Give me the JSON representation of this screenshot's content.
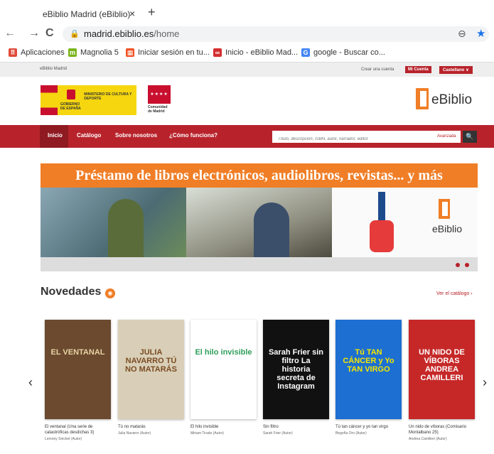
{
  "browser": {
    "tab_title": "eBiblio Madrid (eBiblio)",
    "tab_close": "×",
    "new_tab": "+",
    "back": "←",
    "forward": "→",
    "reload": "C",
    "url_host": "madrid.ebiblio.es",
    "url_path": "/home",
    "zoom": "⊖",
    "star": "★",
    "bookmarks": [
      {
        "label": "Aplicaciones",
        "icon": "apps-grid-icon",
        "color": "#e04b3a",
        "glyph": "⠿"
      },
      {
        "label": "Magnolia 5",
        "icon": "magnolia-icon",
        "color": "#7ab51d",
        "glyph": "m"
      },
      {
        "label": "Iniciar sesión en tu...",
        "icon": "microsoft-icon",
        "color": "#f25022",
        "glyph": "▦"
      },
      {
        "label": "Inicio - eBiblio Mad...",
        "icon": "ebiblio-icon",
        "color": "#d32f2f",
        "glyph": "∞"
      },
      {
        "label": "google - Buscar co...",
        "icon": "google-icon",
        "color": "#4285f4",
        "glyph": "G"
      }
    ]
  },
  "topbar": {
    "brand": "eBiblio Madrid",
    "create_account": "Crear una cuenta",
    "my_account": "Mi Cuenta",
    "language": "Castellano ∨"
  },
  "logos": {
    "gov_left": "GOBIERNO DE ESPAÑA",
    "gov_right": "MINISTERIO DE CULTURA Y DEPORTE",
    "cam_stars": "★★★★",
    "cam_name": "Comunidad de Madrid",
    "ebiblio_name": "eBiblio"
  },
  "nav": {
    "items": [
      "Inicio",
      "Catálogo",
      "Sobre nosotros",
      "¿Cómo funciona?"
    ],
    "search_placeholder": "Título, descripción, ISBN, autor, narrador, editor",
    "advanced": "Avanzada",
    "search_icon": "🔍"
  },
  "banner": {
    "headline": "Préstamo de libros electrónicos, audiolibros, revistas... y más",
    "logo_text": "eBiblio"
  },
  "novedades": {
    "title": "Novedades",
    "rss_glyph": "◉",
    "catalog_link": "Ver el catálogo ›",
    "prev": "‹",
    "next": "›",
    "books": [
      {
        "title": "El ventanal (Una serie de catastróficas desdichas 3)",
        "author": "Lemony Snicket (Autor)",
        "cover_text": "EL VENTANAL",
        "bg": "#6b4a2f",
        "fg": "#e7d3a6"
      },
      {
        "title": "Tú no matarás",
        "author": "Julia Navarro (Autor)",
        "cover_text": "JULIA NAVARRO  TÚ NO MATARÁS",
        "bg": "#d9cfb8",
        "fg": "#7a4b22"
      },
      {
        "title": "El hilo invisible",
        "author": "Miriam Tirado (Autor)",
        "cover_text": "El hilo invisible",
        "bg": "#ffffff",
        "fg": "#2e9e5b"
      },
      {
        "title": "Sin filtro",
        "author": "Sarah Frier (Autor)",
        "cover_text": "Sarah Frier  sin filtro  La historia secreta de Instagram",
        "bg": "#111111",
        "fg": "#ffffff"
      },
      {
        "title": "Tú tan cáncer y yo tan virgo",
        "author": "Begoña Oro (Autor)",
        "cover_text": "Tú TAN CÁNCER y Yo TAN VIRGO",
        "bg": "#1d6fd1",
        "fg": "#f3e600"
      },
      {
        "title": "Un nido de víboras (Comisario Montalbano 25)",
        "author": "Andrea Camilleri (Autor)",
        "cover_text": "UN NIDO DE VÍBORAS  ANDREA CAMILLERI",
        "bg": "#c62828",
        "fg": "#ffffff"
      }
    ]
  }
}
